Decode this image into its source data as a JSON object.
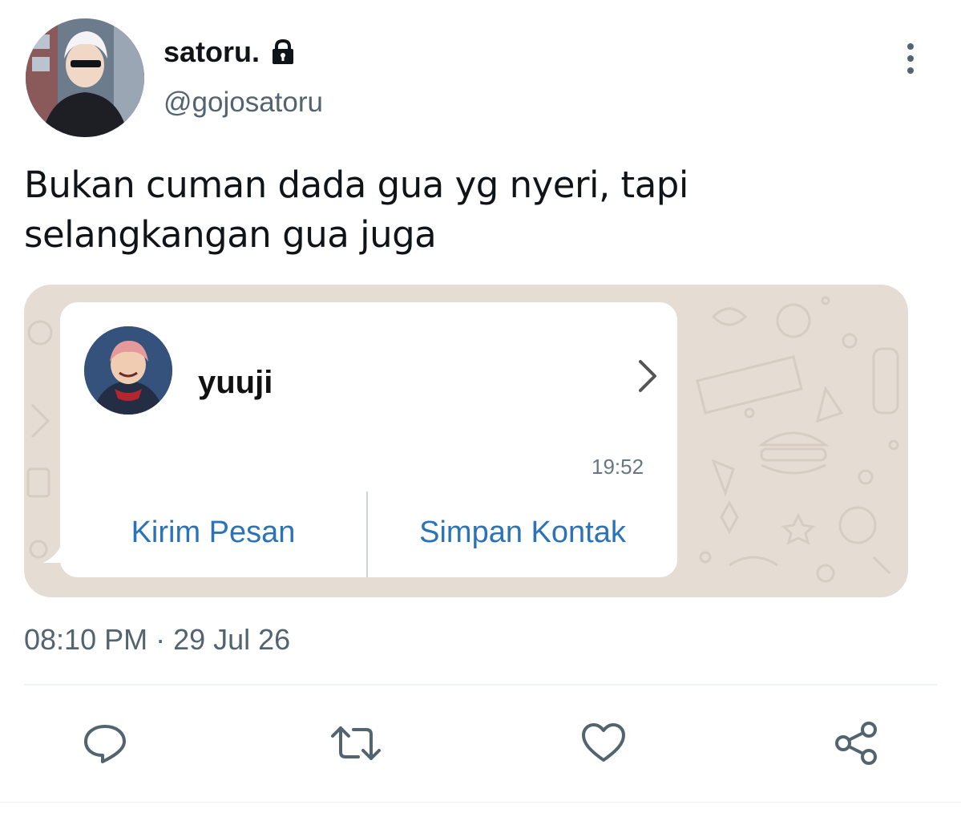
{
  "tweet": {
    "display_name": "satoru.",
    "handle": "@gojosatoru",
    "text": "Bukan cuman dada gua yg nyeri, tapi selangkangan gua juga",
    "timestamp": "08:10 PM · 29 Jul 26",
    "icons": {
      "lock": "lock-icon",
      "more": "more-vertical-icon"
    }
  },
  "media": {
    "contact_card": {
      "name": "yuuji",
      "time": "19:52",
      "actions": [
        "Kirim Pesan",
        "Simpan Kontak"
      ]
    },
    "colors": {
      "background": "#e5ddd4",
      "action_text": "#2a73b9"
    }
  },
  "action_bar": {
    "icons": [
      "reply-icon",
      "retweet-icon",
      "like-icon",
      "share-icon"
    ]
  },
  "colors": {
    "primary_text": "#0f1419",
    "secondary_text": "#536471"
  }
}
